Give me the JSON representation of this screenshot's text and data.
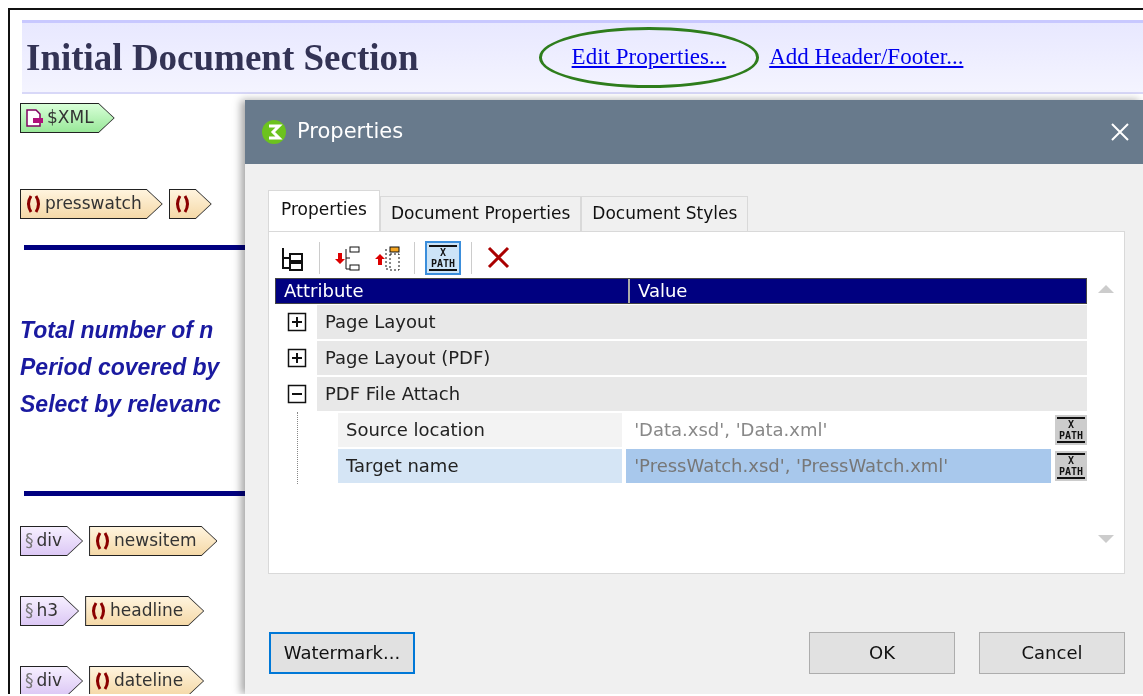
{
  "document": {
    "title": "Initial Document Section",
    "links": [
      {
        "label": "Edit Properties...",
        "highlighted": true
      },
      {
        "label": "Add Header/Footer...",
        "highlighted": false
      }
    ],
    "blocks": [
      {
        "kind": "tags",
        "tags": [
          {
            "kind": "xml",
            "label": "$XML"
          }
        ]
      },
      {
        "kind": "tags",
        "tags": [
          {
            "kind": "element",
            "label": "presswatch"
          },
          {
            "kind": "element"
          }
        ]
      },
      {
        "kind": "rule"
      },
      {
        "kind": "text",
        "lines": [
          "Total number of n",
          "Period covered by",
          "Select by relevanc"
        ]
      },
      {
        "kind": "rule"
      },
      {
        "kind": "tags",
        "tags": [
          {
            "kind": "html",
            "symbol": "§",
            "label": "div"
          },
          {
            "kind": "element",
            "label": "newsitem"
          }
        ]
      },
      {
        "kind": "tags",
        "tags": [
          {
            "kind": "html",
            "symbol": "§",
            "label": "h3"
          },
          {
            "kind": "element",
            "label": "headline"
          }
        ]
      },
      {
        "kind": "tags",
        "tags": [
          {
            "kind": "html",
            "symbol": "§",
            "label": "div"
          },
          {
            "kind": "element",
            "label": "dateline"
          }
        ]
      }
    ]
  },
  "dialog": {
    "title": "Properties",
    "tabs": [
      {
        "label": "Properties",
        "selected": true
      },
      {
        "label": "Document Properties",
        "selected": false
      },
      {
        "label": "Document Styles",
        "selected": false
      }
    ],
    "toolbar": [
      {
        "kind": "tree"
      },
      {
        "kind": "separator"
      },
      {
        "kind": "insert-before"
      },
      {
        "kind": "insert-after"
      },
      {
        "kind": "separator"
      },
      {
        "kind": "xpath",
        "pressed": true,
        "top": "X",
        "bottom": "PATH"
      },
      {
        "kind": "separator"
      },
      {
        "kind": "delete"
      }
    ],
    "table": {
      "columns": [
        "Attribute",
        "Value"
      ],
      "rows": [
        {
          "label": "Page Layout",
          "expanded": false
        },
        {
          "label": "Page Layout (PDF)",
          "expanded": false
        },
        {
          "label": "PDF File Attach",
          "expanded": true,
          "children": [
            {
              "label": "Source location",
              "value": "'Data.xsd', 'Data.xml'",
              "selected": false,
              "xpath": {
                "top": "X",
                "bottom": "PATH"
              }
            },
            {
              "label": "Target name",
              "value": "'PressWatch.xsd', 'PressWatch.xml'",
              "selected": true,
              "xpath": {
                "top": "X",
                "bottom": "PATH"
              }
            }
          ]
        }
      ]
    },
    "buttons": [
      {
        "label": "Watermark...",
        "focused": true
      },
      {
        "label": "OK",
        "focused": false
      },
      {
        "label": "Cancel",
        "focused": false
      }
    ]
  }
}
